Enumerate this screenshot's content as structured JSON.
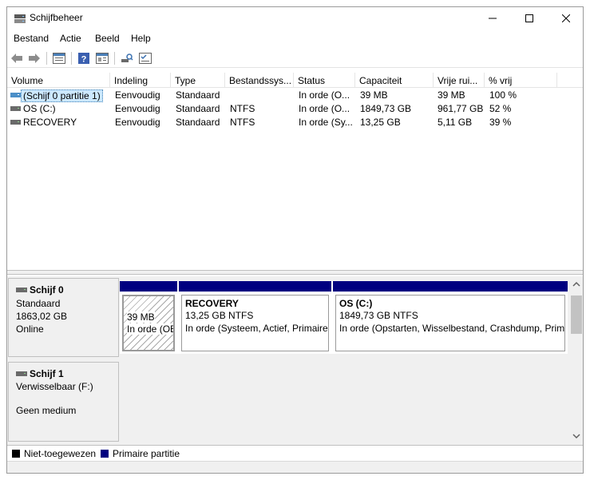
{
  "window": {
    "title": "Schijfbeheer"
  },
  "menu": [
    "Bestand",
    "Actie",
    "Beeld",
    "Help"
  ],
  "toolbar": {
    "icons": [
      "back-arrow-icon",
      "forward-arrow-icon",
      "volume-list-icon",
      "help-icon",
      "properties-icon",
      "disk-search-icon",
      "disk-list-icon"
    ]
  },
  "volume_list": {
    "columns": [
      "Volume",
      "Indeling",
      "Type",
      "Bestandssys...",
      "Status",
      "Capaciteit",
      "Vrije rui...",
      "% vrij"
    ],
    "rows": [
      {
        "volume": "(Schijf 0 partitie 1)",
        "layout": "Eenvoudig",
        "type": "Standaard",
        "fs": "",
        "status": "In orde (O...",
        "capacity": "39 MB",
        "free": "39 MB",
        "pct": "100 %",
        "selected": true
      },
      {
        "volume": "OS (C:)",
        "layout": "Eenvoudig",
        "type": "Standaard",
        "fs": "NTFS",
        "status": "In orde (O...",
        "capacity": "1849,73 GB",
        "free": "961,77 GB",
        "pct": "52 %",
        "selected": false
      },
      {
        "volume": "RECOVERY",
        "layout": "Eenvoudig",
        "type": "Standaard",
        "fs": "NTFS",
        "status": "In orde (Sy...",
        "capacity": "13,25 GB",
        "free": "5,11 GB",
        "pct": "39 %",
        "selected": false
      }
    ]
  },
  "disks": [
    {
      "name": "Schijf 0",
      "kind": "Standaard",
      "size": "1863,02 GB",
      "state": "Online",
      "partitions": [
        {
          "name": "",
          "size": "39 MB",
          "status": "In orde (OEM-partitie)",
          "unallocated_style": true
        },
        {
          "name": "RECOVERY",
          "size": "13,25 GB NTFS",
          "status": "In orde (Systeem, Actief, Primaire partitie)",
          "unallocated_style": false
        },
        {
          "name": "OS  (C:)",
          "size": "1849,73 GB NTFS",
          "status": "In orde (Opstarten, Wisselbestand, Crashdump, Primaire partitie)",
          "unallocated_style": false
        }
      ]
    },
    {
      "name": "Schijf 1",
      "kind": "Verwisselbaar (F:)",
      "size": "",
      "state": "Geen medium"
    }
  ],
  "legend": [
    {
      "label": "Niet-toegewezen",
      "color": "#000000"
    },
    {
      "label": "Primaire partitie",
      "color": "#000080"
    }
  ],
  "colors": {
    "primary_partition": "#000080",
    "selection": "#cce8ff"
  }
}
